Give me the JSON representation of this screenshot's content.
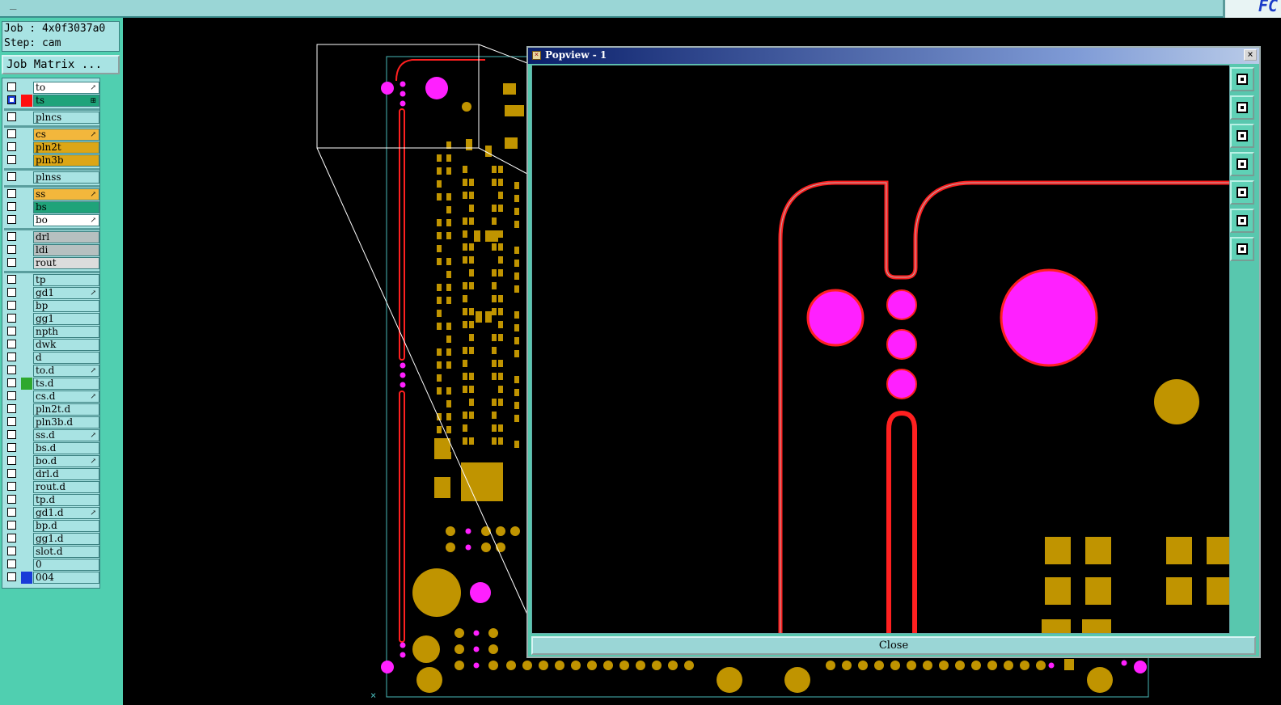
{
  "app": {
    "logo_text": "FC"
  },
  "job": {
    "job_line": "Job : 4x0f3037a0",
    "step_line": "Step: cam"
  },
  "job_matrix_button": "Job Matrix ...",
  "layers": [
    {
      "name": "to",
      "bg": "#ffffff",
      "swatch": "",
      "marker": "↗",
      "selected": false
    },
    {
      "name": "ts",
      "bg": "#1fa37a",
      "swatch": "#ff1010",
      "marker": "⊞",
      "selected": true
    },
    {
      "name": "plncs",
      "bg": "#a8e3e3",
      "swatch": "",
      "marker": "",
      "selected": false
    },
    {
      "name": "cs",
      "bg": "#f3b73c",
      "swatch": "",
      "marker": "↗",
      "selected": false
    },
    {
      "name": "pln2t",
      "bg": "#dca617",
      "swatch": "",
      "marker": "",
      "selected": false
    },
    {
      "name": "pln3b",
      "bg": "#dca617",
      "swatch": "",
      "marker": "",
      "selected": false
    },
    {
      "name": "plnss",
      "bg": "#a8e3e3",
      "swatch": "",
      "marker": "",
      "selected": false
    },
    {
      "name": "ss",
      "bg": "#f3b73c",
      "swatch": "",
      "marker": "↗",
      "selected": false
    },
    {
      "name": "bs",
      "bg": "#1fa37a",
      "swatch": "",
      "marker": "",
      "selected": false
    },
    {
      "name": "bo",
      "bg": "#ffffff",
      "swatch": "",
      "marker": "↗",
      "selected": false
    },
    {
      "name": "drl",
      "bg": "#b6c0c0",
      "swatch": "",
      "marker": "",
      "selected": false
    },
    {
      "name": "ldi",
      "bg": "#b6c0c0",
      "swatch": "",
      "marker": "",
      "selected": false
    },
    {
      "name": "rout",
      "bg": "#dcdcdc",
      "swatch": "",
      "marker": "",
      "selected": false
    },
    {
      "name": "tp",
      "bg": "#a8e3e3",
      "swatch": "",
      "marker": "",
      "selected": false
    },
    {
      "name": "gd1",
      "bg": "#a8e3e3",
      "swatch": "",
      "marker": "↗",
      "selected": false
    },
    {
      "name": "bp",
      "bg": "#a8e3e3",
      "swatch": "",
      "marker": "",
      "selected": false
    },
    {
      "name": "gg1",
      "bg": "#a8e3e3",
      "swatch": "",
      "marker": "",
      "selected": false
    },
    {
      "name": "npth",
      "bg": "#a8e3e3",
      "swatch": "",
      "marker": "",
      "selected": false
    },
    {
      "name": "dwk",
      "bg": "#a8e3e3",
      "swatch": "",
      "marker": "",
      "selected": false
    },
    {
      "name": "d",
      "bg": "#a8e3e3",
      "swatch": "",
      "marker": "",
      "selected": false
    },
    {
      "name": "to.d",
      "bg": "#a8e3e3",
      "swatch": "",
      "marker": "↗",
      "selected": false
    },
    {
      "name": "ts.d",
      "bg": "#a8e3e3",
      "swatch": "#2ea82e",
      "marker": "",
      "selected": false
    },
    {
      "name": "cs.d",
      "bg": "#a8e3e3",
      "swatch": "",
      "marker": "↗",
      "selected": false
    },
    {
      "name": "pln2t.d",
      "bg": "#a8e3e3",
      "swatch": "",
      "marker": "",
      "selected": false
    },
    {
      "name": "pln3b.d",
      "bg": "#a8e3e3",
      "swatch": "",
      "marker": "",
      "selected": false
    },
    {
      "name": "ss.d",
      "bg": "#a8e3e3",
      "swatch": "",
      "marker": "↗",
      "selected": false
    },
    {
      "name": "bs.d",
      "bg": "#a8e3e3",
      "swatch": "",
      "marker": "",
      "selected": false
    },
    {
      "name": "bo.d",
      "bg": "#a8e3e3",
      "swatch": "",
      "marker": "↗",
      "selected": false
    },
    {
      "name": "drl.d",
      "bg": "#a8e3e3",
      "swatch": "",
      "marker": "",
      "selected": false
    },
    {
      "name": "rout.d",
      "bg": "#a8e3e3",
      "swatch": "",
      "marker": "",
      "selected": false
    },
    {
      "name": "tp.d",
      "bg": "#a8e3e3",
      "swatch": "",
      "marker": "",
      "selected": false
    },
    {
      "name": "gd1.d",
      "bg": "#a8e3e3",
      "swatch": "",
      "marker": "↗",
      "selected": false
    },
    {
      "name": "bp.d",
      "bg": "#a8e3e3",
      "swatch": "",
      "marker": "",
      "selected": false
    },
    {
      "name": "gg1.d",
      "bg": "#a8e3e3",
      "swatch": "",
      "marker": "",
      "selected": false
    },
    {
      "name": "slot.d",
      "bg": "#a8e3e3",
      "swatch": "",
      "marker": "",
      "selected": false
    },
    {
      "name": "0",
      "bg": "#a8e3e3",
      "swatch": "",
      "marker": "",
      "selected": false
    },
    {
      "name": "004",
      "bg": "#a8e3e3",
      "swatch": "#1a3cd8",
      "marker": "",
      "selected": false
    }
  ],
  "popview": {
    "title": "Popview - 1",
    "close_x": "×",
    "close_button": "Close",
    "tools": [
      "zoom-window-icon",
      "pan-up-icon",
      "pan-down-icon",
      "pan-left-icon",
      "pan-right-icon",
      "zoom-fit-icon",
      "zoom-home-icon"
    ]
  },
  "colors": {
    "outline": "#ff0000",
    "pad": "#c09400",
    "hole": "#ff20ff",
    "ui_teal": "#58c7ae"
  }
}
